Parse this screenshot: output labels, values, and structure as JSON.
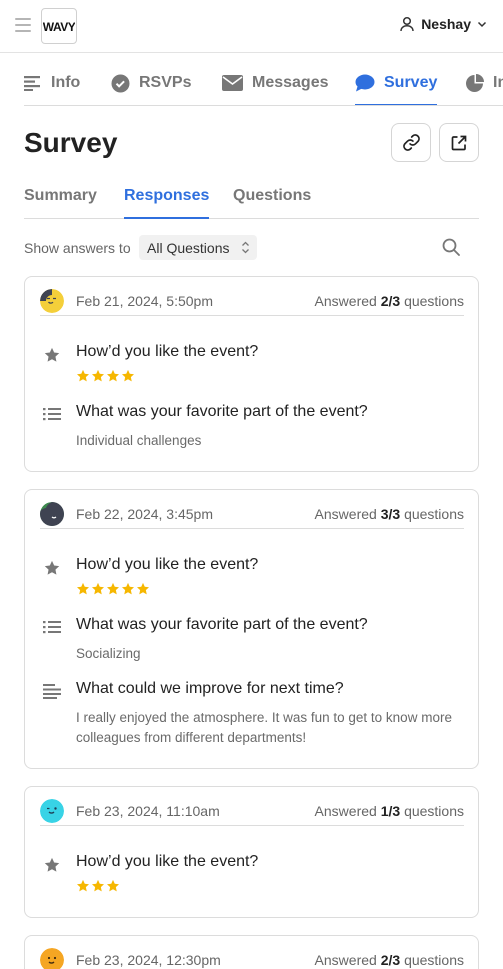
{
  "header": {
    "logo_text": "WAVY",
    "user_name": "Neshay"
  },
  "tabs": [
    {
      "label": "Info",
      "icon": "lines-icon"
    },
    {
      "label": "RSVPs",
      "icon": "check-circle-icon"
    },
    {
      "label": "Messages",
      "icon": "envelope-icon"
    },
    {
      "label": "Survey",
      "icon": "chat-bubble-icon",
      "active": true
    },
    {
      "label": "Insights",
      "icon": "pie-chart-icon"
    }
  ],
  "page": {
    "title": "Survey",
    "copy_link_icon": "link-icon",
    "open_external_icon": "external-link-icon"
  },
  "subtabs": [
    {
      "label": "Summary"
    },
    {
      "label": "Responses",
      "active": true
    },
    {
      "label": "Questions"
    }
  ],
  "filter": {
    "label": "Show answers to",
    "selected": "All Questions"
  },
  "colors": {
    "accent": "#2f6fde",
    "star": "#f6b700"
  },
  "responses": [
    {
      "date": "Feb 21, 2024, 5:50pm",
      "answered_prefix": "Answered",
      "answered": "2/3",
      "answered_suffix": "questions",
      "avatar_color": "#f4cf3a",
      "answers": [
        {
          "question": "How’d you like the event?",
          "type": "rating",
          "rating": 4
        },
        {
          "question": "What was your favorite part of the event?",
          "type": "choice",
          "answer": "Individual challenges"
        }
      ]
    },
    {
      "date": "Feb 22, 2024, 3:45pm",
      "answered_prefix": "Answered",
      "answered": "3/3",
      "answered_suffix": "questions",
      "avatar_color": "#3e8a4f",
      "answers": [
        {
          "question": "How’d you like the event?",
          "type": "rating",
          "rating": 5
        },
        {
          "question": "What was your favorite part of the event?",
          "type": "choice",
          "answer": "Socializing"
        },
        {
          "question": "What could we improve for next time?",
          "type": "text",
          "answer": "I really enjoyed the atmosphere. It was fun to get to know more colleagues from different departments!"
        }
      ]
    },
    {
      "date": "Feb 23, 2024, 11:10am",
      "answered_prefix": "Answered",
      "answered": "1/3",
      "answered_suffix": "questions",
      "avatar_color": "#38d3e6",
      "answers": [
        {
          "question": "How’d you like the event?",
          "type": "rating",
          "rating": 3
        }
      ]
    },
    {
      "date": "Feb 23, 2024, 12:30pm",
      "answered_prefix": "Answered",
      "answered": "2/3",
      "answered_suffix": "questions",
      "avatar_color": "#f5a623",
      "answers": []
    }
  ]
}
